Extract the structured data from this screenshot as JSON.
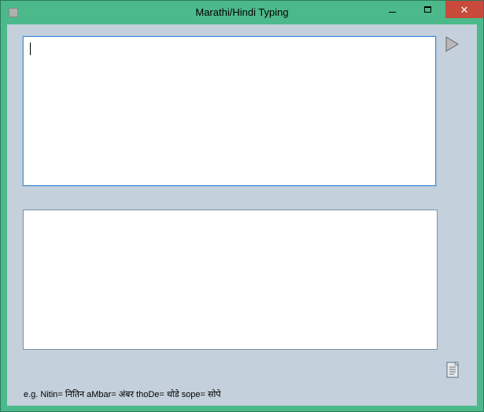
{
  "window": {
    "title": "Marathi/Hindi Typing"
  },
  "input_text": "",
  "output_text": "",
  "hint_text": "e.g. Nitin= नितिन  aMbar= अंबर   thoDe= थोडे   sope= सोपे"
}
